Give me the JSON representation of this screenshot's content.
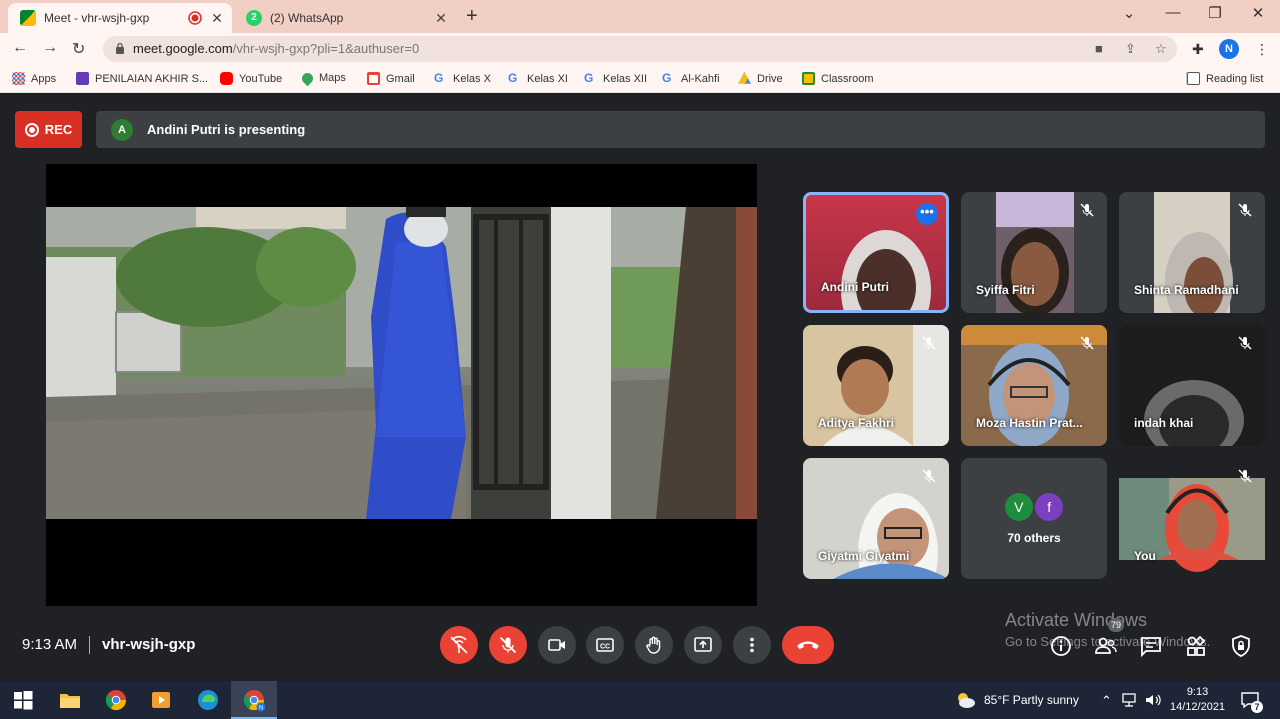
{
  "browser": {
    "tabs": [
      {
        "title": "Meet - vhr-wsjh-gxp",
        "active": true,
        "recording": true
      },
      {
        "title": "(2) WhatsApp",
        "active": false,
        "badge": "2"
      }
    ],
    "new_tab": "+",
    "address": {
      "host": "meet.google.com",
      "path": "/vhr-wsjh-gxp?pli=1&authuser=0"
    },
    "profile_initial": "N",
    "bookmarks": [
      "Apps",
      "PENILAIAN AKHIR S...",
      "YouTube",
      "Maps",
      "Gmail",
      "Kelas X",
      "Kelas XI",
      "Kelas XII",
      "Al-Kahfi",
      "Drive",
      "Classroom"
    ],
    "reading_list": "Reading list"
  },
  "meet": {
    "rec_label": "REC",
    "presenter": {
      "initial": "A",
      "text": "Andini Putri is presenting"
    },
    "participants": [
      {
        "name": "Andini Putri",
        "active_speaker": true,
        "muted": false
      },
      {
        "name": "Syiffa Fitri",
        "muted": true
      },
      {
        "name": "Shinta Ramadhani",
        "muted": true
      },
      {
        "name": "Aditya Fakhri",
        "muted": true
      },
      {
        "name": "Moza Hastin Prat...",
        "muted": true
      },
      {
        "name": "indah khai",
        "muted": true
      },
      {
        "name": "Giyatmi Giyatmi",
        "muted": true
      },
      {
        "name": "70 others",
        "avatars": [
          "V",
          "f"
        ],
        "avatar_colors": [
          "#1e8e3e",
          "#7b3fbf"
        ]
      },
      {
        "name": "You",
        "muted": true
      }
    ],
    "time": "9:13 AM",
    "meeting_code": "vhr-wsjh-gxp",
    "people_count": "79",
    "colors": {
      "accent": "#8ab4f8",
      "danger": "#ea4335",
      "surface": "#3c4043"
    }
  },
  "windows": {
    "watermark_title": "Activate Windows",
    "watermark_sub": "Go to Settings to activate Windows.",
    "weather": "85°F  Partly sunny",
    "clock_time": "9:13",
    "clock_date": "14/12/2021",
    "notification_count": "7"
  }
}
